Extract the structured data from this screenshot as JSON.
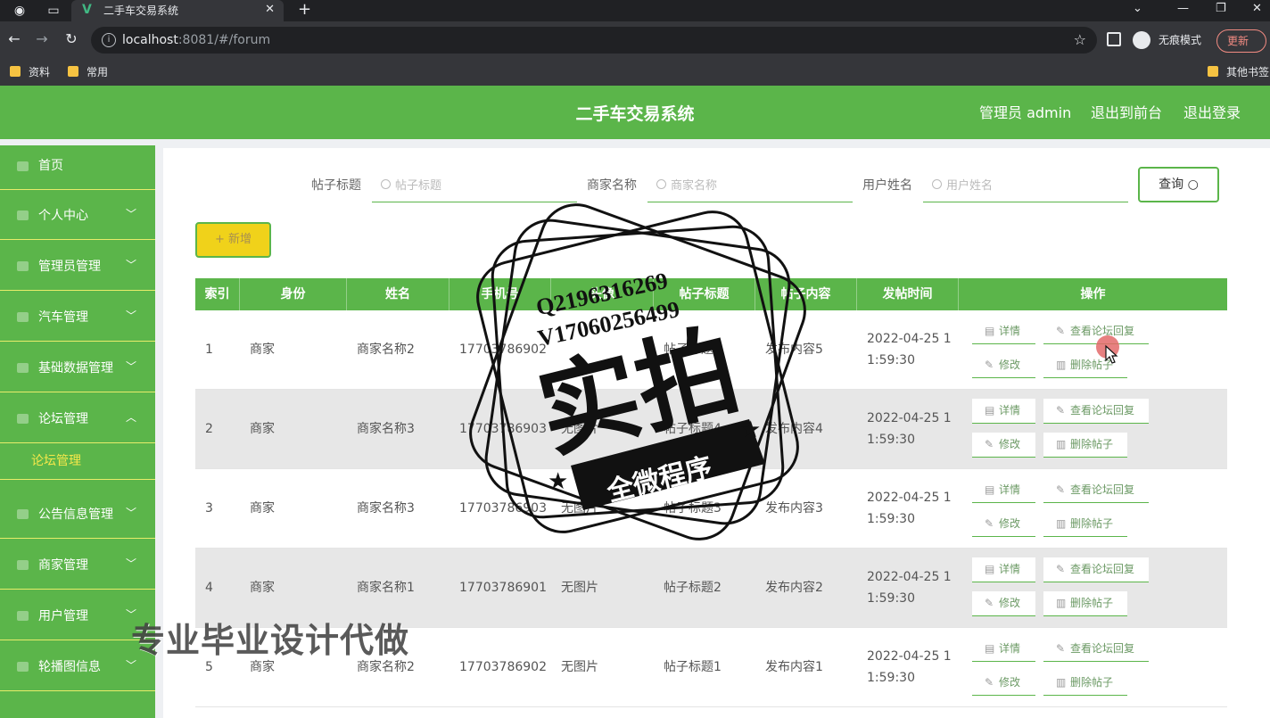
{
  "browser": {
    "tab_title": "二手车交易系统",
    "url_host": "localhost",
    "url_rest": ":8081/#/forum",
    "incognito_label": "无痕模式",
    "update_label": "更新",
    "bookmarks": [
      "资料",
      "常用"
    ],
    "other_bookmarks": "其他书签"
  },
  "header": {
    "title": "二手车交易系统",
    "admin": "管理员 admin",
    "to_front": "退出到前台",
    "logout": "退出登录"
  },
  "sidebar": {
    "items": [
      {
        "label": "首页"
      },
      {
        "label": "个人中心"
      },
      {
        "label": "管理员管理"
      },
      {
        "label": "汽车管理"
      },
      {
        "label": "基础数据管理"
      },
      {
        "label": "论坛管理"
      },
      {
        "label": "公告信息管理"
      },
      {
        "label": "商家管理"
      },
      {
        "label": "用户管理"
      },
      {
        "label": "轮播图信息"
      }
    ],
    "submenu": "论坛管理"
  },
  "search": {
    "title_label": "帖子标题",
    "title_placeholder": "帖子标题",
    "merchant_label": "商家名称",
    "merchant_placeholder": "商家名称",
    "user_label": "用户姓名",
    "user_placeholder": "用户姓名",
    "query_button": "查询"
  },
  "toolbar": {
    "add_button": "+ 新增"
  },
  "table": {
    "columns": [
      "索引",
      "身份",
      "姓名",
      "手机号",
      "头像",
      "帖子标题",
      "帖子内容",
      "发帖时间",
      "操作"
    ],
    "actions": {
      "detail": "详情",
      "view_reply": "查看论坛回复",
      "edit": "修改",
      "delete": "删除帖子"
    },
    "rows": [
      {
        "index": "1",
        "role": "商家",
        "name": "商家名称2",
        "phone": "17703786902",
        "avatar": "",
        "title": "帖子标题5",
        "content": "发布内容5",
        "time_line1": "2022-04-25 1",
        "time_line2": "1:59:30"
      },
      {
        "index": "2",
        "role": "商家",
        "name": "商家名称3",
        "phone": "17703786903",
        "avatar": "无图片",
        "title": "帖子标题4",
        "content": "发布内容4",
        "time_line1": "2022-04-25 1",
        "time_line2": "1:59:30"
      },
      {
        "index": "3",
        "role": "商家",
        "name": "商家名称3",
        "phone": "17703786903",
        "avatar": "无图片",
        "title": "帖子标题3",
        "content": "发布内容3",
        "time_line1": "2022-04-25 1",
        "time_line2": "1:59:30"
      },
      {
        "index": "4",
        "role": "商家",
        "name": "商家名称1",
        "phone": "17703786901",
        "avatar": "无图片",
        "title": "帖子标题2",
        "content": "发布内容2",
        "time_line1": "2022-04-25 1",
        "time_line2": "1:59:30"
      },
      {
        "index": "5",
        "role": "商家",
        "name": "商家名称2",
        "phone": "17703786902",
        "avatar": "无图片",
        "title": "帖子标题1",
        "content": "发布内容1",
        "time_line1": "2022-04-25 1",
        "time_line2": "1:59:30"
      }
    ]
  },
  "watermark": {
    "qq": "Q2196316269",
    "wechat": "V17060256499",
    "big": "实拍",
    "ribbon": "全微程序",
    "bottom": "专业毕业设计代做"
  },
  "colors": {
    "primary": "#5bb54a",
    "add_button": "#f0d21a",
    "submenu_text": "#f5e84a"
  }
}
